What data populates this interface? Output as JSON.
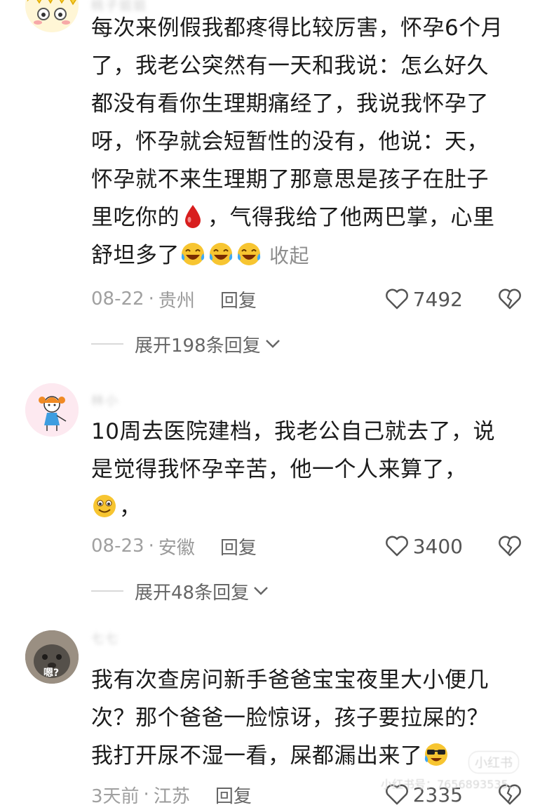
{
  "comments": [
    {
      "username": "桃子姐姐",
      "text_lines": [
        "每次来例假我都疼得比较厉害，怀孕6个月",
        "了，我老公突然有一天和我说：怎么好久",
        "都没有看你生理期痛经了，我说我怀孕了",
        "呀，怀孕就会短暂性的没有，他说：天，",
        "怀孕就不来生理期了那意思是孩子在肚子"
      ],
      "line6_before": "里吃你的",
      "line6_after": "，气得我给了他两巴掌，心里",
      "line7_before": "舒坦多了",
      "collapse_label": "收起",
      "date": "08-22",
      "location": "贵州",
      "reply_label": "回复",
      "likes": "7492",
      "expand_label": "展开198条回复"
    },
    {
      "username": "林小",
      "text_lines": [
        "10周去医院建档，我老公自己就去了，说",
        "是觉得我怀孕辛苦，他一个人来算了，"
      ],
      "line3_after": "，",
      "date": "08-23",
      "location": "安徽",
      "reply_label": "回复",
      "likes": "3400",
      "expand_label": "展开48条回复"
    },
    {
      "username": "七七",
      "avatar_text": "嗯?",
      "text_lines": [
        "我有次查房问新手爸爸宝宝夜里大小便几",
        "次？那个爸爸一脸惊讶，孩子要拉屎的？"
      ],
      "line3_before": "我打开尿不湿一看，屎都漏出来了",
      "date": "3天前",
      "location": "江苏",
      "reply_label": "回复",
      "likes": "2335"
    }
  ],
  "separator": "·",
  "watermark": {
    "badge": "小红书",
    "text": "小红书号：7656893535..."
  },
  "colors": {
    "text": "#1b1b1b",
    "meta": "#9a9a9a",
    "blood": "#d81e1e",
    "emoji": "#f7c531"
  }
}
